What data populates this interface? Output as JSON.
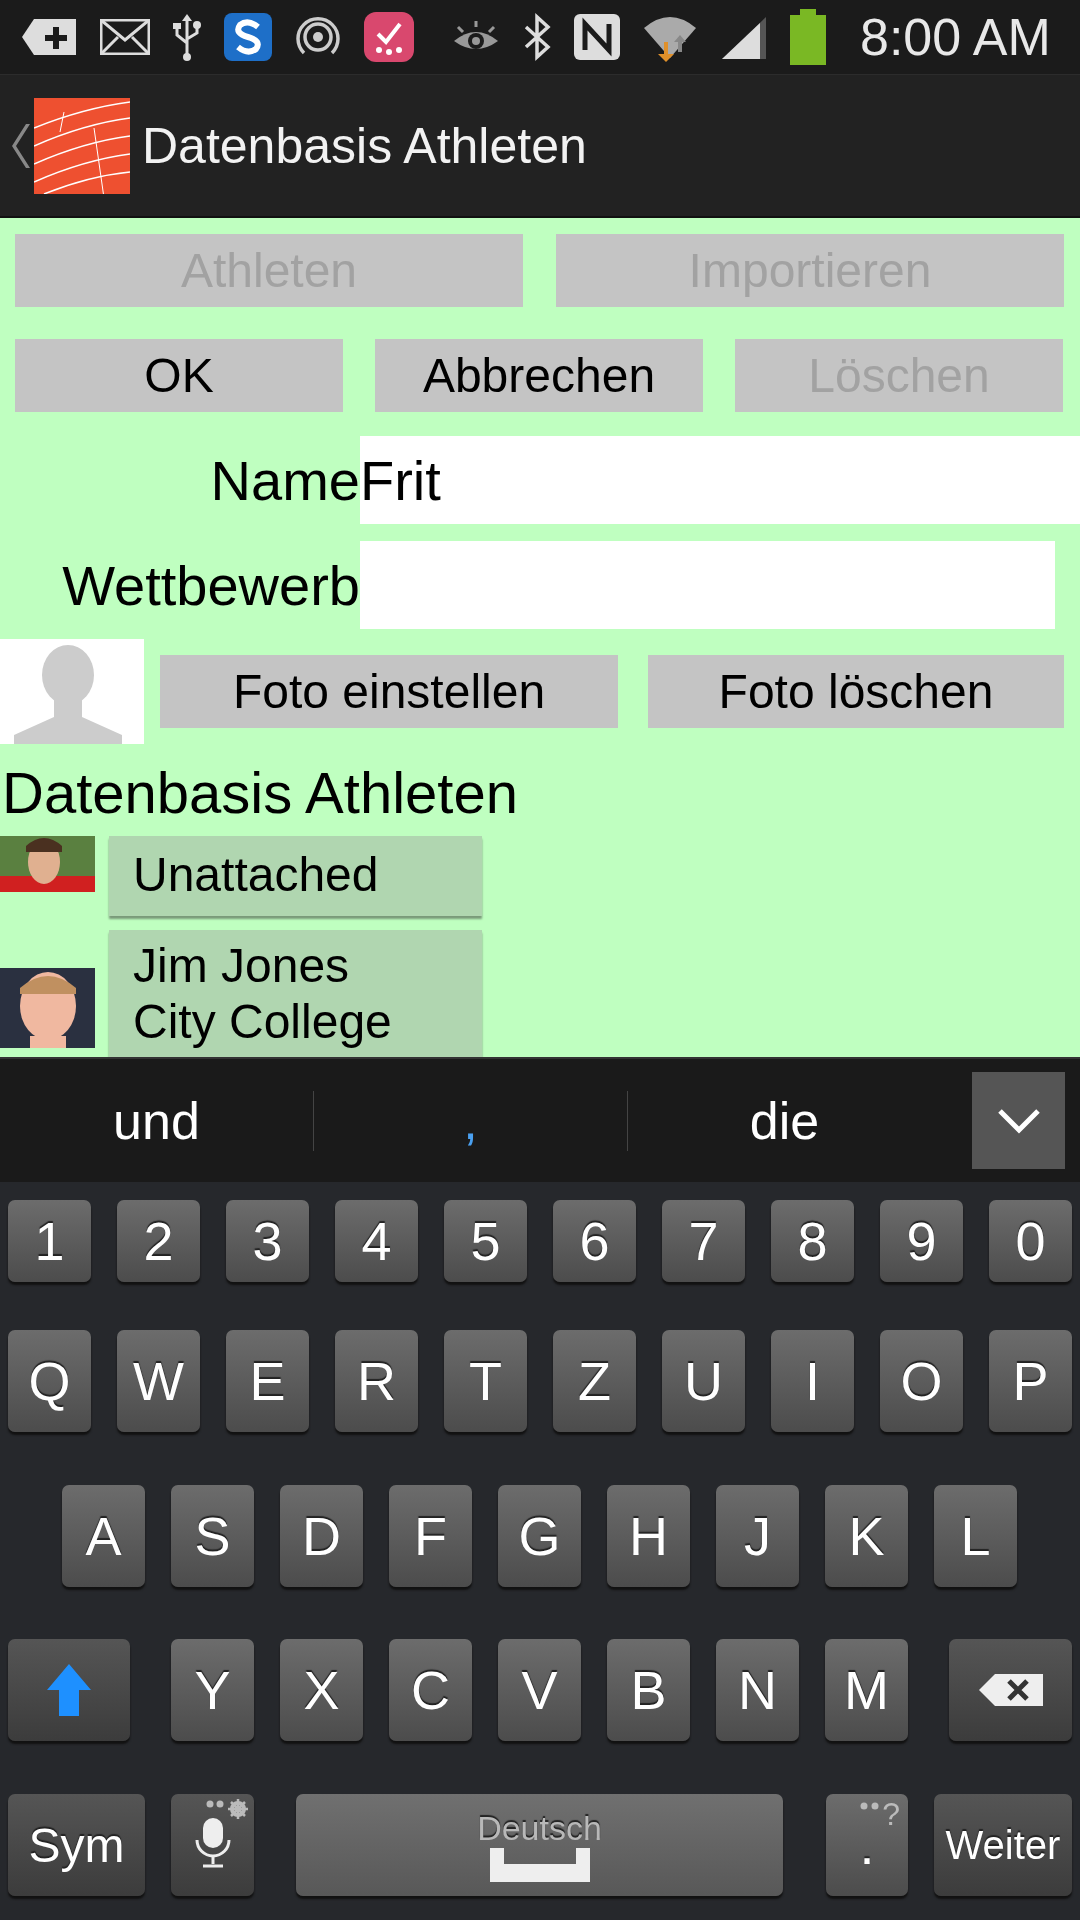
{
  "status_bar": {
    "time": "8:00 AM"
  },
  "app_bar": {
    "title": "Datenbasis Athleten"
  },
  "top_buttons": [
    {
      "label": "Athleten",
      "disabled": true
    },
    {
      "label": "Importieren",
      "disabled": true
    }
  ],
  "action_buttons": [
    {
      "label": "OK",
      "disabled": false
    },
    {
      "label": "Abbrechen",
      "disabled": false
    },
    {
      "label": "Löschen",
      "disabled": true
    }
  ],
  "fields": [
    {
      "label": "Name",
      "value": "Frit"
    },
    {
      "label": "Wettbewerb"
    }
  ],
  "photo_buttons": [
    {
      "label": "Foto einstellen"
    },
    {
      "label": "Foto löschen"
    }
  ],
  "list": {
    "heading": "Datenbasis Athleten",
    "items": [
      {
        "lines": [
          "Unattached"
        ]
      },
      {
        "lines": [
          "Jim Jones",
          "City College"
        ]
      }
    ]
  },
  "keyboard": {
    "suggestions": [
      {
        "text": "und",
        "highlighted": false
      },
      {
        "text": ",",
        "highlighted": true
      },
      {
        "text": "die",
        "highlighted": false
      }
    ],
    "number_row": [
      "1",
      "2",
      "3",
      "4",
      "5",
      "6",
      "7",
      "8",
      "9",
      "0"
    ],
    "letter_rows": [
      [
        "Q",
        "W",
        "E",
        "R",
        "T",
        "Z",
        "U",
        "I",
        "O",
        "P"
      ],
      [
        "A",
        "S",
        "D",
        "F",
        "G",
        "H",
        "J",
        "K",
        "L"
      ],
      [
        "Y",
        "X",
        "C",
        "V",
        "B",
        "N",
        "M"
      ]
    ],
    "shift_on": true,
    "bottom_row": [
      {
        "kind": "sym",
        "label": "Sym"
      },
      {
        "kind": "mic"
      },
      {
        "kind": "space",
        "label": "Deutsch"
      },
      {
        "kind": "period",
        "label": ".",
        "hint": "?"
      },
      {
        "kind": "enter",
        "label": "Weiter"
      }
    ]
  }
}
